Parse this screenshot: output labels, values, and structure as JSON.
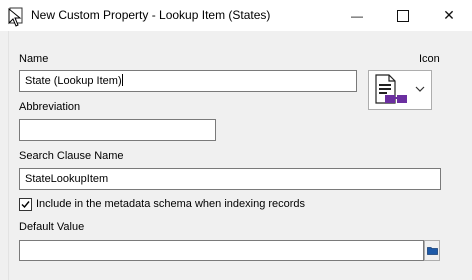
{
  "window": {
    "title": "New Custom Property - Lookup Item (States)",
    "minimize_glyph": "—",
    "close_glyph": "✕"
  },
  "form": {
    "name_label": "Name",
    "name_value": "State (Lookup Item)",
    "icon_label": "Icon",
    "icon_name": "document-glasses-icon",
    "abbreviation_label": "Abbreviation",
    "abbreviation_value": "",
    "search_clause_label": "Search Clause Name",
    "search_clause_value": "StateLookupItem",
    "include_metadata_label": "Include in the metadata schema when indexing records",
    "include_metadata_checked": true,
    "default_value_label": "Default Value",
    "default_value": ""
  },
  "colors": {
    "accent_purple": "#6b2fa0",
    "border": "#7a7a7a",
    "background": "#f0f0f0"
  }
}
